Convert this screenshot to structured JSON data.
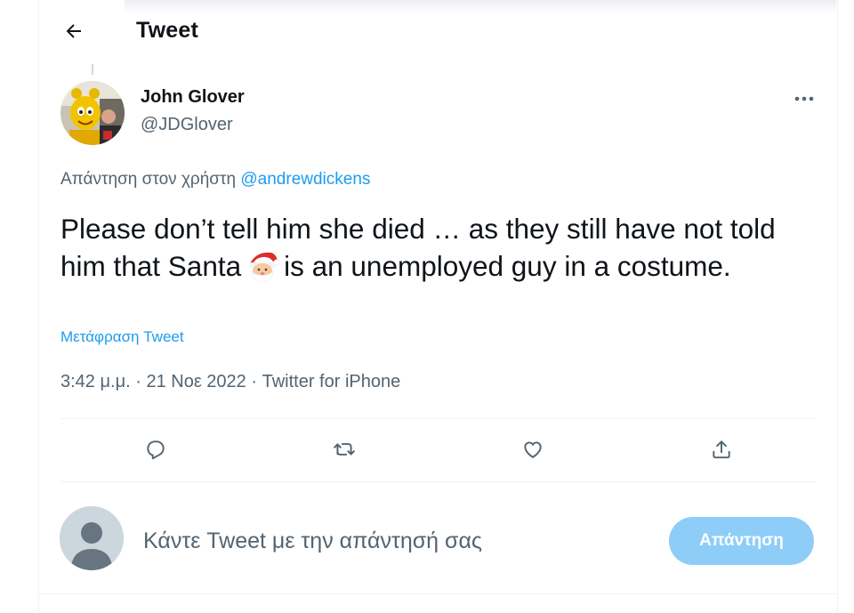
{
  "header": {
    "title": "Tweet",
    "back_icon": "arrow-left-icon"
  },
  "tweet": {
    "author_name": "John Glover",
    "author_handle": "@JDGlover",
    "reply_prefix": "Απάντηση στον χρήστη",
    "reply_mention": "@andrewdickens",
    "text_before_emoji": "Please don’t tell him she died … as they still have not told him that Santa",
    "emoji": "santa-emoji",
    "text_after_emoji": "is an unemployed guy in a costume.",
    "translate_link": "Μετάφραση Tweet",
    "time": "3:42 μ.μ.",
    "date": "21 Νοε 2022",
    "source": "Twitter for iPhone",
    "separator": "·"
  },
  "actions": [
    "reply-icon",
    "retweet-icon",
    "like-icon",
    "share-icon"
  ],
  "composer": {
    "placeholder": "Κάντε Tweet με την απάντησή σας",
    "reply_button_label": "Απάντηση"
  },
  "colors": {
    "accent": "#1d9bf0",
    "reply_button_disabled": "#8ecdf8",
    "secondary_text": "#536471",
    "primary_text": "#0f1419",
    "divider": "#eff3f4"
  }
}
